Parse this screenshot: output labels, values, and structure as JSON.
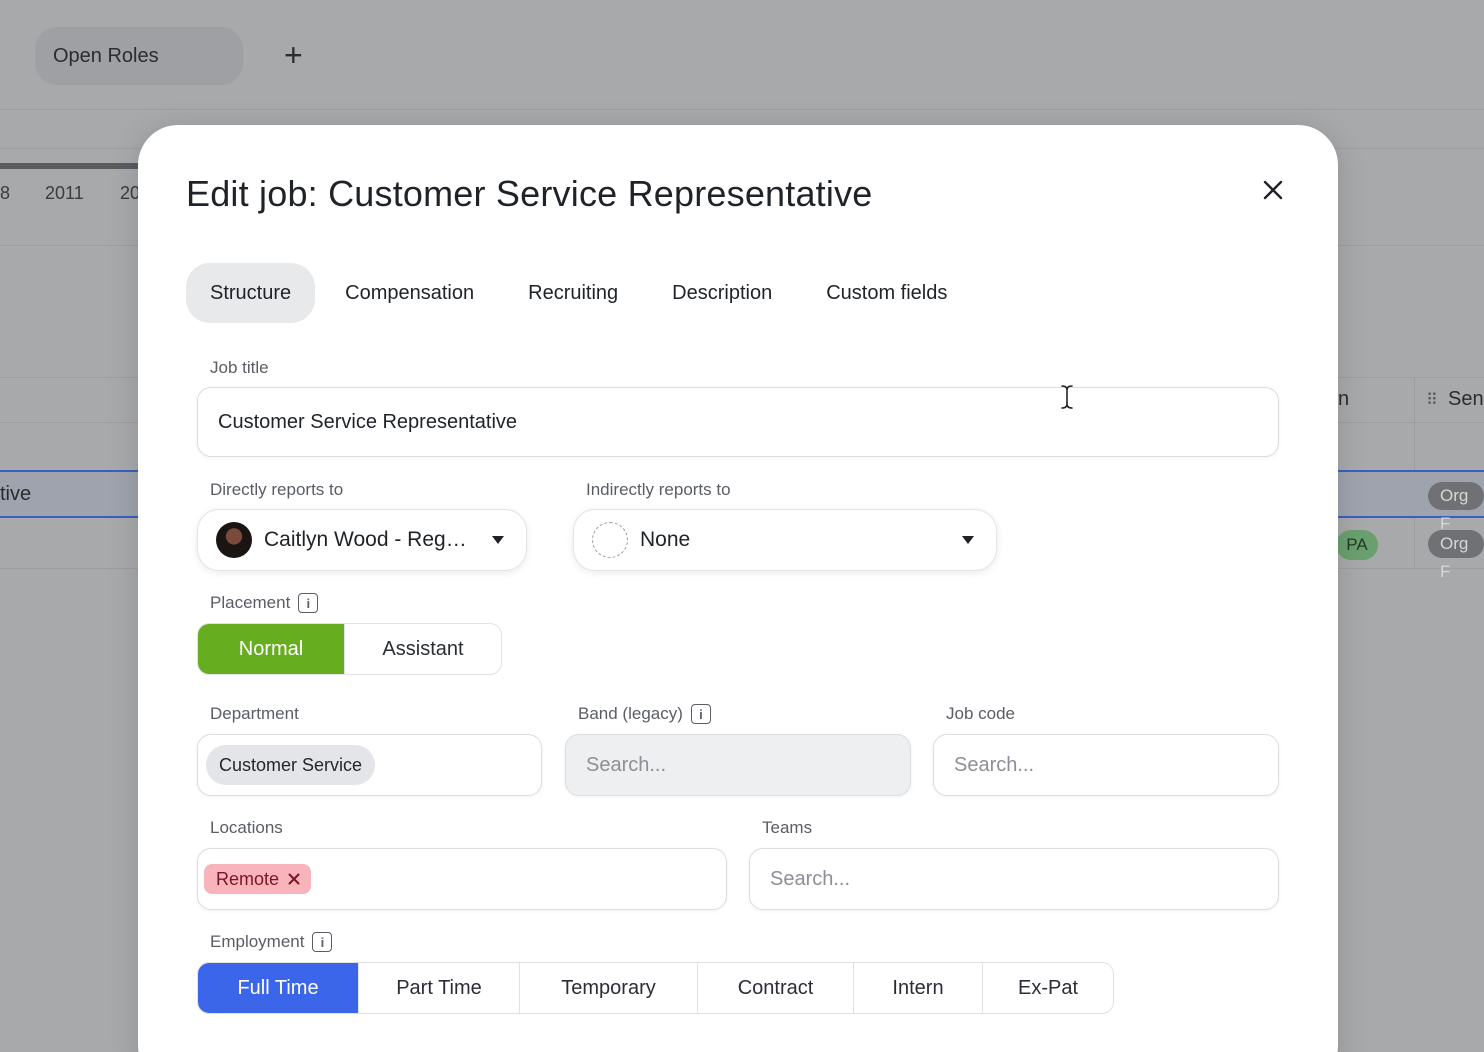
{
  "background": {
    "tab_label": "Open Roles",
    "add_icon": "plus-icon",
    "years": [
      "8",
      "2011",
      "20"
    ],
    "selected_row_text": "tive",
    "column_header_n": "n",
    "column_header_sen": "Sen",
    "pill_pa": "PA",
    "pill_org_1": "Org F",
    "pill_org_2": "Org F"
  },
  "modal": {
    "title": "Edit job: Customer Service Representative",
    "close_icon": "close-icon",
    "tabs": [
      {
        "label": "Structure",
        "active": true
      },
      {
        "label": "Compensation",
        "active": false
      },
      {
        "label": "Recruiting",
        "active": false
      },
      {
        "label": "Description",
        "active": false
      },
      {
        "label": "Custom fields",
        "active": false
      }
    ],
    "job_title": {
      "label": "Job title",
      "value": "Customer Service Representative"
    },
    "direct_reports": {
      "label": "Directly reports to",
      "value": "Caitlyn Wood - Reg…"
    },
    "indirect_reports": {
      "label": "Indirectly reports to",
      "value": "None"
    },
    "placement": {
      "label": "Placement",
      "options": [
        "Normal",
        "Assistant"
      ],
      "selected": "Normal",
      "accent": "#66ad1f"
    },
    "department": {
      "label": "Department",
      "chip": "Customer Service"
    },
    "band": {
      "label": "Band (legacy)",
      "placeholder": "Search..."
    },
    "job_code": {
      "label": "Job code",
      "placeholder": "Search..."
    },
    "locations": {
      "label": "Locations",
      "chip": "Remote"
    },
    "teams": {
      "label": "Teams",
      "placeholder": "Search..."
    },
    "employment": {
      "label": "Employment",
      "options": [
        "Full Time",
        "Part Time",
        "Temporary",
        "Contract",
        "Intern",
        "Ex-Pat"
      ],
      "selected": "Full Time",
      "accent": "#3c66e9"
    }
  }
}
